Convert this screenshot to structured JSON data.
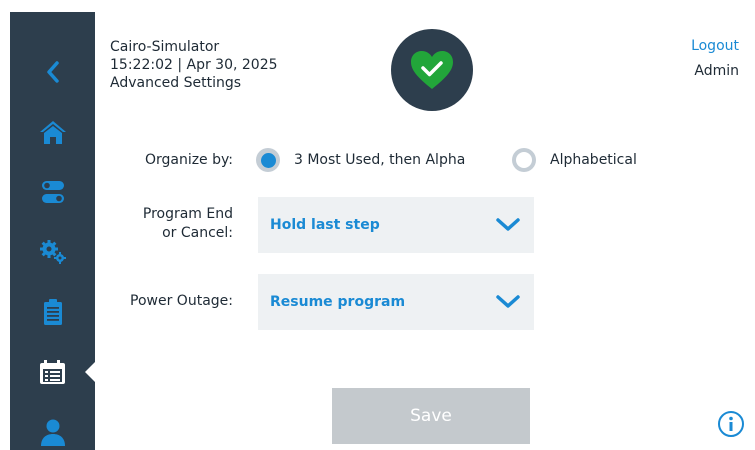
{
  "header": {
    "device_name": "Cairo-Simulator",
    "datetime": "15:22:02 | Apr 30, 2025",
    "page_title": "Advanced Settings",
    "status_icon": "heart-check-icon",
    "logout_label": "Logout",
    "user_role": "Admin"
  },
  "sidebar": {
    "items": [
      {
        "icon": "back-chevron-icon"
      },
      {
        "icon": "home-icon"
      },
      {
        "icon": "toggle-switches-icon"
      },
      {
        "icon": "gears-icon"
      },
      {
        "icon": "clipboard-icon"
      },
      {
        "icon": "list-calendar-icon",
        "active": true
      },
      {
        "icon": "user-icon"
      }
    ]
  },
  "settings": {
    "organize_by": {
      "label": "Organize by:",
      "options": [
        "3 Most Used, then Alpha",
        "Alphabetical"
      ],
      "selected": "3 Most Used, then Alpha"
    },
    "program_end": {
      "label_line1": "Program End",
      "label_line2": "or Cancel:",
      "value": "Hold last step"
    },
    "power_outage": {
      "label": "Power Outage:",
      "value": "Resume program"
    }
  },
  "actions": {
    "save_label": "Save",
    "info_icon": "info-icon"
  },
  "colors": {
    "sidebar_bg": "#2d3e4d",
    "accent_blue": "#1a8ad4",
    "status_green": "#22a63a",
    "disabled_button": "#c4c9cd",
    "select_bg": "#eef1f3"
  }
}
